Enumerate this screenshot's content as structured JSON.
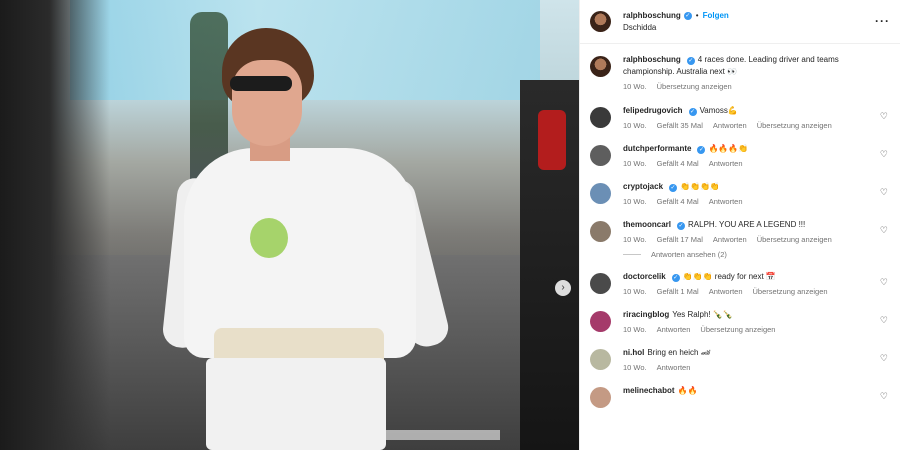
{
  "photo": {},
  "post_header": {
    "username": "ralphboschung",
    "follow_label": "Folgen",
    "location": "Dschidda"
  },
  "caption": {
    "username": "ralphboschung",
    "text": "4 races done. Leading driver and teams championship. Australia next 👀",
    "time": "10 Wo.",
    "translate_label": "Übersetzung anzeigen"
  },
  "comments": [
    {
      "username": "felipedrugovich",
      "verified": true,
      "text": "Vamoss💪",
      "time": "10 Wo.",
      "likes": "Gefällt 35 Mal",
      "reply": "Antworten",
      "translate": "Übersetzung anzeigen",
      "avatar_color": "#3a3a3a"
    },
    {
      "username": "dutchperformante",
      "verified": true,
      "text": "🔥🔥🔥👏",
      "time": "10 Wo.",
      "likes": "Gefällt 4 Mal",
      "reply": "Antworten",
      "translate": "",
      "avatar_color": "#5e5e5e"
    },
    {
      "username": "cryptojack",
      "verified": true,
      "text": "👏👏👏👏",
      "time": "10 Wo.",
      "likes": "Gefällt 4 Mal",
      "reply": "Antworten",
      "translate": "",
      "avatar_color": "#6b8fb5"
    },
    {
      "username": "themooncarl",
      "verified": true,
      "text": "RALPH. YOU ARE A LEGEND !!!",
      "time": "10 Wo.",
      "likes": "Gefällt 17 Mal",
      "reply": "Antworten",
      "translate": "Übersetzung anzeigen",
      "avatar_color": "#8a7a6a",
      "replies": "Antworten ansehen (2)"
    },
    {
      "username": "doctorcelik",
      "verified": true,
      "text": "👏👏👏 ready for next 📅",
      "time": "10 Wo.",
      "likes": "Gefällt 1 Mal",
      "reply": "Antworten",
      "translate": "Übersetzung anzeigen",
      "avatar_color": "#4a4a4a"
    },
    {
      "username": "riracingblog",
      "verified": false,
      "text": "Yes Ralph! 🍾🍾",
      "time": "10 Wo.",
      "likes": "",
      "reply": "Antworten",
      "translate": "Übersetzung anzeigen",
      "avatar_color": "#a53a6a"
    },
    {
      "username": "ni.hol",
      "verified": false,
      "text": "Bring en heich 🏎",
      "time": "10 Wo.",
      "likes": "",
      "reply": "Antworten",
      "translate": "",
      "avatar_color": "#b8b8a0"
    },
    {
      "username": "melinechabot",
      "verified": false,
      "text": "🔥🔥",
      "time": "",
      "likes": "",
      "reply": "",
      "translate": "",
      "avatar_color": "#c49a84"
    }
  ],
  "icons": {
    "verified": "verified-badge-icon",
    "heart": "heart-outline-icon",
    "more": "more-options-icon",
    "next": "chevron-right-icon"
  }
}
